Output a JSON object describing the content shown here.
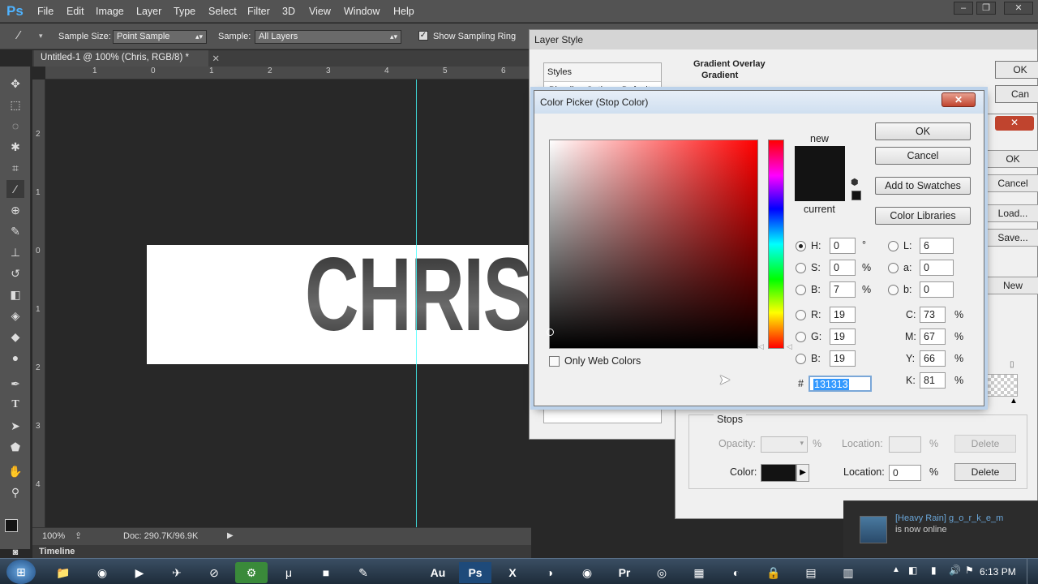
{
  "app": {
    "logo": "Ps"
  },
  "menu": [
    "File",
    "Edit",
    "Image",
    "Layer",
    "Type",
    "Select",
    "Filter",
    "3D",
    "View",
    "Window",
    "Help"
  ],
  "options": {
    "sample_size_label": "Sample Size:",
    "sample_size_value": "Point Sample",
    "sample_label": "Sample:",
    "sample_value": "All Layers",
    "show_ring_label": "Show Sampling Ring"
  },
  "document": {
    "tab_title": "Untitled-1 @ 100% (Chris, RGB/8) *",
    "artboard_text": "CHRIS",
    "zoom": "100%",
    "doc_info": "Doc: 290.7K/96.9K",
    "timeline_label": "Timeline",
    "ruler_top": [
      "1",
      "0",
      "1",
      "2",
      "3",
      "4",
      "5",
      "6"
    ],
    "ruler_left": [
      "2",
      "1",
      "0",
      "1",
      "2",
      "3",
      "4"
    ]
  },
  "layer_style": {
    "title": "Layer Style",
    "styles_header": "Styles",
    "blending_options": "Blending Options: Default",
    "section_title": "Gradient Overlay",
    "subsection": "Gradient",
    "ok_label": "OK",
    "cancel_label": "Can"
  },
  "gradient_editor": {
    "ok_label": "OK",
    "cancel_label": "Cancel",
    "load_label": "Load...",
    "save_label": "Save...",
    "new_label": "New",
    "stops_title": "Stops",
    "opacity_label": "Opacity:",
    "pct": "%",
    "location_label": "Location:",
    "delete_label": "Delete",
    "color_label": "Color:",
    "location_value": "0",
    "stop_color": "#131313"
  },
  "color_picker": {
    "title": "Color Picker (Stop Color)",
    "ok_label": "OK",
    "cancel_label": "Cancel",
    "add_swatches_label": "Add to Swatches",
    "color_libraries_label": "Color Libraries",
    "new_label": "new",
    "current_label": "current",
    "only_web_label": "Only Web Colors",
    "hsb": {
      "H": "0",
      "S": "0",
      "B": "7"
    },
    "rgb": {
      "R": "19",
      "G": "19",
      "B": "19"
    },
    "lab": {
      "L": "6",
      "a": "0",
      "b": "0"
    },
    "cmyk": {
      "C": "73",
      "M": "67",
      "Y": "66",
      "K": "81"
    },
    "hex": "131313",
    "hex_prefix": "#",
    "degree_unit": "°",
    "pct_unit": "%",
    "selected_color": "#131313"
  },
  "notification": {
    "name": "[Heavy Rain] g_o_r_k_e_m",
    "status": "is now online"
  },
  "taskbar": {
    "clock": "6:13 PM"
  }
}
